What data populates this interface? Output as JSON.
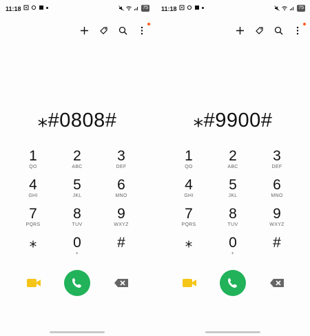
{
  "screens": [
    {
      "status": {
        "time": "11:18",
        "battery": "75"
      },
      "number": "⁎#0808#",
      "keys": [
        {
          "digit": "1",
          "letters": "QO"
        },
        {
          "digit": "2",
          "letters": "ABC"
        },
        {
          "digit": "3",
          "letters": "DEF"
        },
        {
          "digit": "4",
          "letters": "GHI"
        },
        {
          "digit": "5",
          "letters": "JKL"
        },
        {
          "digit": "6",
          "letters": "MNO"
        },
        {
          "digit": "7",
          "letters": "PQRS"
        },
        {
          "digit": "8",
          "letters": "TUV"
        },
        {
          "digit": "9",
          "letters": "WXYZ"
        },
        {
          "digit": "⁎",
          "letters": ""
        },
        {
          "digit": "0",
          "letters": "+"
        },
        {
          "digit": "#",
          "letters": ""
        }
      ]
    },
    {
      "status": {
        "time": "11:18",
        "battery": "75"
      },
      "number": "⁎#9900#",
      "keys": [
        {
          "digit": "1",
          "letters": "QO"
        },
        {
          "digit": "2",
          "letters": "ABC"
        },
        {
          "digit": "3",
          "letters": "DEF"
        },
        {
          "digit": "4",
          "letters": "GHI"
        },
        {
          "digit": "5",
          "letters": "JKL"
        },
        {
          "digit": "6",
          "letters": "MNO"
        },
        {
          "digit": "7",
          "letters": "PQRS"
        },
        {
          "digit": "8",
          "letters": "TUV"
        },
        {
          "digit": "9",
          "letters": "WXYZ"
        },
        {
          "digit": "⁎",
          "letters": ""
        },
        {
          "digit": "0",
          "letters": "+"
        },
        {
          "digit": "#",
          "letters": ""
        }
      ]
    }
  ],
  "icons": {
    "toolbar": [
      "add-icon",
      "tag-icon",
      "search-icon",
      "more-options-icon"
    ],
    "bottom": [
      "video-call-icon",
      "phone-icon",
      "backspace-icon"
    ]
  },
  "colors": {
    "call_green": "#21b25a",
    "video_yellow": "#f5c518",
    "notification_dot": "#ff5a1f"
  }
}
